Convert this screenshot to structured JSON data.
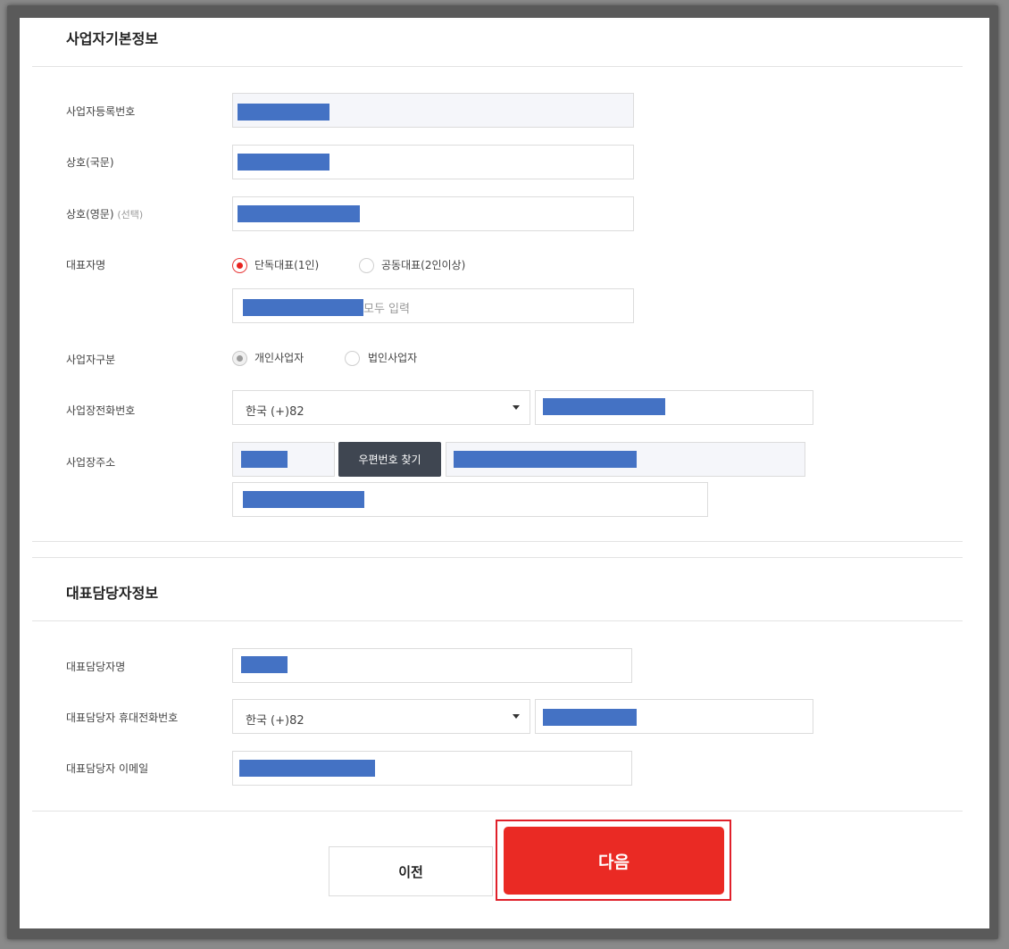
{
  "business_info": {
    "title": "사업자기본정보",
    "reg_number_label": "사업자등록번호",
    "name_kr_label": "상호(국문)",
    "name_en_label": "상호(영문)",
    "name_en_sub": "(선택)",
    "ceo_label": "대표자명",
    "ceo_type_single": "단독대표(1인)",
    "ceo_type_joint": "공동대표(2인이상)",
    "ceo_name_hint": "모두 입력",
    "biz_type_label": "사업자구분",
    "biz_type_individual": "개인사업자",
    "biz_type_corporate": "법인사업자",
    "phone_label": "사업장전화번호",
    "phone_country": "한국 (+)82",
    "address_label": "사업장주소",
    "zip_search_button": "우편번호 찾기"
  },
  "contact_info": {
    "title": "대표담당자정보",
    "name_label": "대표담당자명",
    "mobile_label": "대표담당자 휴대전화번호",
    "mobile_country": "한국 (+)82",
    "email_label": "대표담당자 이메일"
  },
  "actions": {
    "prev_label": "이전",
    "next_label": "다음"
  },
  "colors": {
    "accent": "#ea2a24",
    "redaction": "#4472c4",
    "dark_button": "#3f4651"
  }
}
